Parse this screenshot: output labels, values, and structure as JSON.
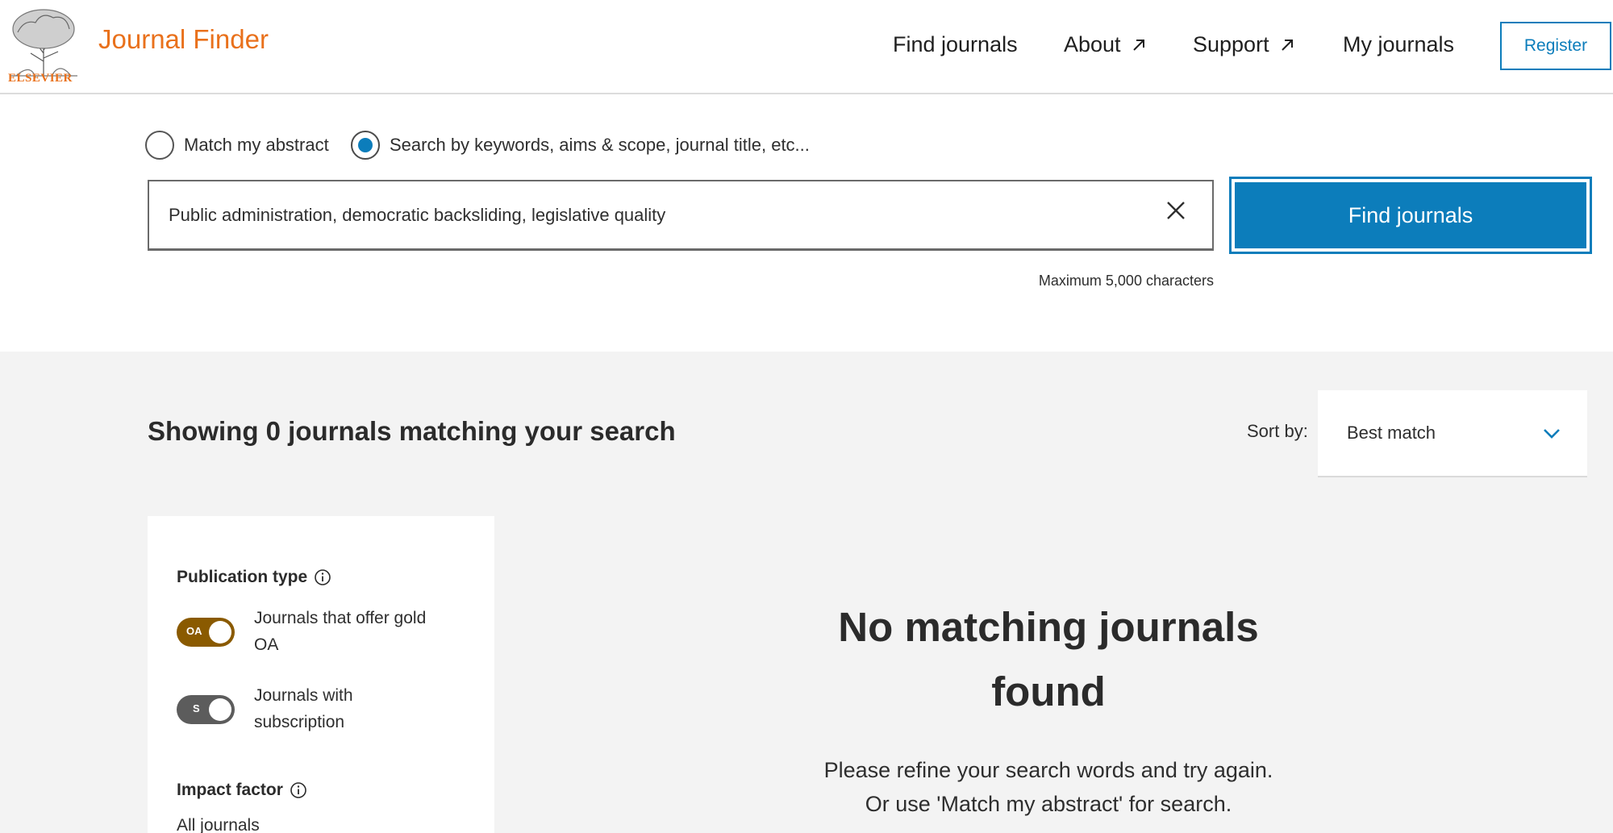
{
  "header": {
    "logo_text": "ELSEVIER",
    "brand": "Journal Finder",
    "nav": {
      "find_journals": "Find journals",
      "about": "About",
      "support": "Support",
      "my_journals": "My journals"
    },
    "register": "Register"
  },
  "search": {
    "mode_abstract": "Match my abstract",
    "mode_keywords": "Search by keywords, aims & scope, journal title, etc...",
    "selected_mode": "keywords",
    "query": "Public administration, democratic backsliding, legislative quality",
    "find_button": "Find journals",
    "max_chars": "Maximum 5,000 characters"
  },
  "results": {
    "summary": "Showing 0 journals matching your search",
    "sort_label": "Sort by:",
    "sort_value": "Best match",
    "empty_title_line1": "No matching journals",
    "empty_title_line2": "found",
    "empty_text_line1": "Please refine your search words and try again.",
    "empty_text_line2": "Or use 'Match my abstract' for search."
  },
  "filters": {
    "publication_type": "Publication type",
    "gold_oa_badge": "OA",
    "gold_oa_line1": "Journals that offer gold",
    "gold_oa_line2": "OA",
    "subscription_badge": "S",
    "subscription_line1": "Journals with",
    "subscription_line2": "subscription",
    "impact_factor": "Impact factor",
    "impact_factor_value": "All journals"
  },
  "colors": {
    "brand_orange": "#e9711c",
    "primary_blue": "#0c7dbb",
    "gold_toggle": "#8a5a00",
    "subscription_toggle": "#5c5c5c",
    "results_bg": "#f3f3f3"
  }
}
